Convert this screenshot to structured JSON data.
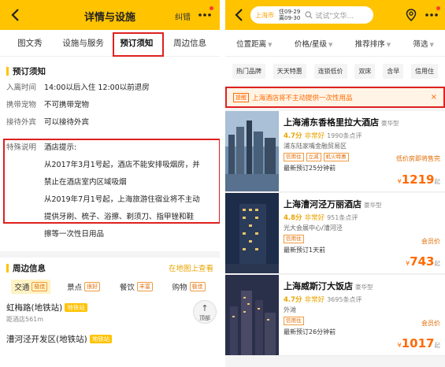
{
  "left": {
    "header": {
      "title": "详情与设施",
      "error_label": "纠错"
    },
    "tabs": [
      {
        "label": "图文秀"
      },
      {
        "label": "设施与服务"
      },
      {
        "label": "预订须知"
      },
      {
        "label": "周边信息"
      }
    ],
    "booking_notice": {
      "title": "预订须知",
      "rows": [
        {
          "key": "入离时间",
          "value": "14:00以后入住 12:00以前退房"
        },
        {
          "key": "携带宠物",
          "value": "不可携带宠物"
        },
        {
          "key": "接待外宾",
          "value": "可以接待外宾"
        }
      ],
      "special": {
        "key": "特殊说明",
        "lines": [
          "酒店提示:",
          "从2017年3月1号起，酒店不能安排吸烟房，并",
          "禁止在酒店室内区域吸烟",
          "从2019年7月1号起，上海旅游住宿业将不主动",
          "提供牙刷、梳子、浴擦、剃须刀、指甲锉和鞋",
          "擦等一次性日用品"
        ]
      }
    },
    "nearby": {
      "title": "周边信息",
      "map_link": "在地图上查看",
      "tabs": [
        {
          "label": "交通",
          "badge": "极佳"
        },
        {
          "label": "景点",
          "badge": "很好"
        },
        {
          "label": "餐饮",
          "badge": "丰富"
        },
        {
          "label": "购物",
          "badge": "极佳"
        }
      ],
      "items": [
        {
          "name": "虹梅路(地铁站)",
          "tag": "地铁站",
          "distance": "距酒店561m"
        },
        {
          "name": "漕河泾开发区(地铁站)",
          "tag": "地铁站",
          "distance": ""
        }
      ],
      "top_button": "顶部"
    }
  },
  "right": {
    "search": {
      "city": "上海市",
      "checkin": "住09-29",
      "checkout": "离09-30",
      "placeholder": "试试\"文华..."
    },
    "filters": [
      "位置距离",
      "价格/星级",
      "推荐排序",
      "筛选"
    ],
    "chips": [
      "热门品牌",
      "天天特惠",
      "连锁低价",
      "双床",
      "含早",
      "信用住"
    ],
    "notice": {
      "tag": "提醒",
      "text": "上海酒店将不主动提供一次性用品",
      "close": "×"
    },
    "hotels": [
      {
        "name": "上海浦东香格里拉大酒店",
        "type": "豪华型",
        "score": "4.7分",
        "word": "非常好",
        "reviews": "1990条点评",
        "location": "浦东陆家嘴金融贸易区",
        "badges": [
          "信用住",
          "立减",
          "机火特惠"
        ],
        "note": "低价房即将售完",
        "booking": "最新预订25分钟前",
        "price": "1219",
        "currency": "¥",
        "suffix": "起"
      },
      {
        "name": "上海漕河泾万丽酒店",
        "type": "豪华型",
        "score": "4.8分",
        "word": "非常好",
        "reviews": "951条点评",
        "location": "光大会展中心/漕河泾",
        "badges": [
          "信用住"
        ],
        "note": "会员价",
        "booking": "最新预订1天前",
        "price": "743",
        "currency": "¥",
        "suffix": "起"
      },
      {
        "name": "上海威斯汀大饭店",
        "type": "豪华型",
        "score": "4.7分",
        "word": "非常好",
        "reviews": "3695条点评",
        "location": "外滩",
        "badges": [
          "信用住"
        ],
        "note": "会员价",
        "booking": "最新预订26分钟前",
        "price": "1017",
        "currency": "¥",
        "suffix": "起"
      }
    ]
  },
  "colors": {
    "brand_yellow": "#ffc300",
    "highlight_red": "#e02020",
    "accent_orange": "#ff6a00"
  }
}
